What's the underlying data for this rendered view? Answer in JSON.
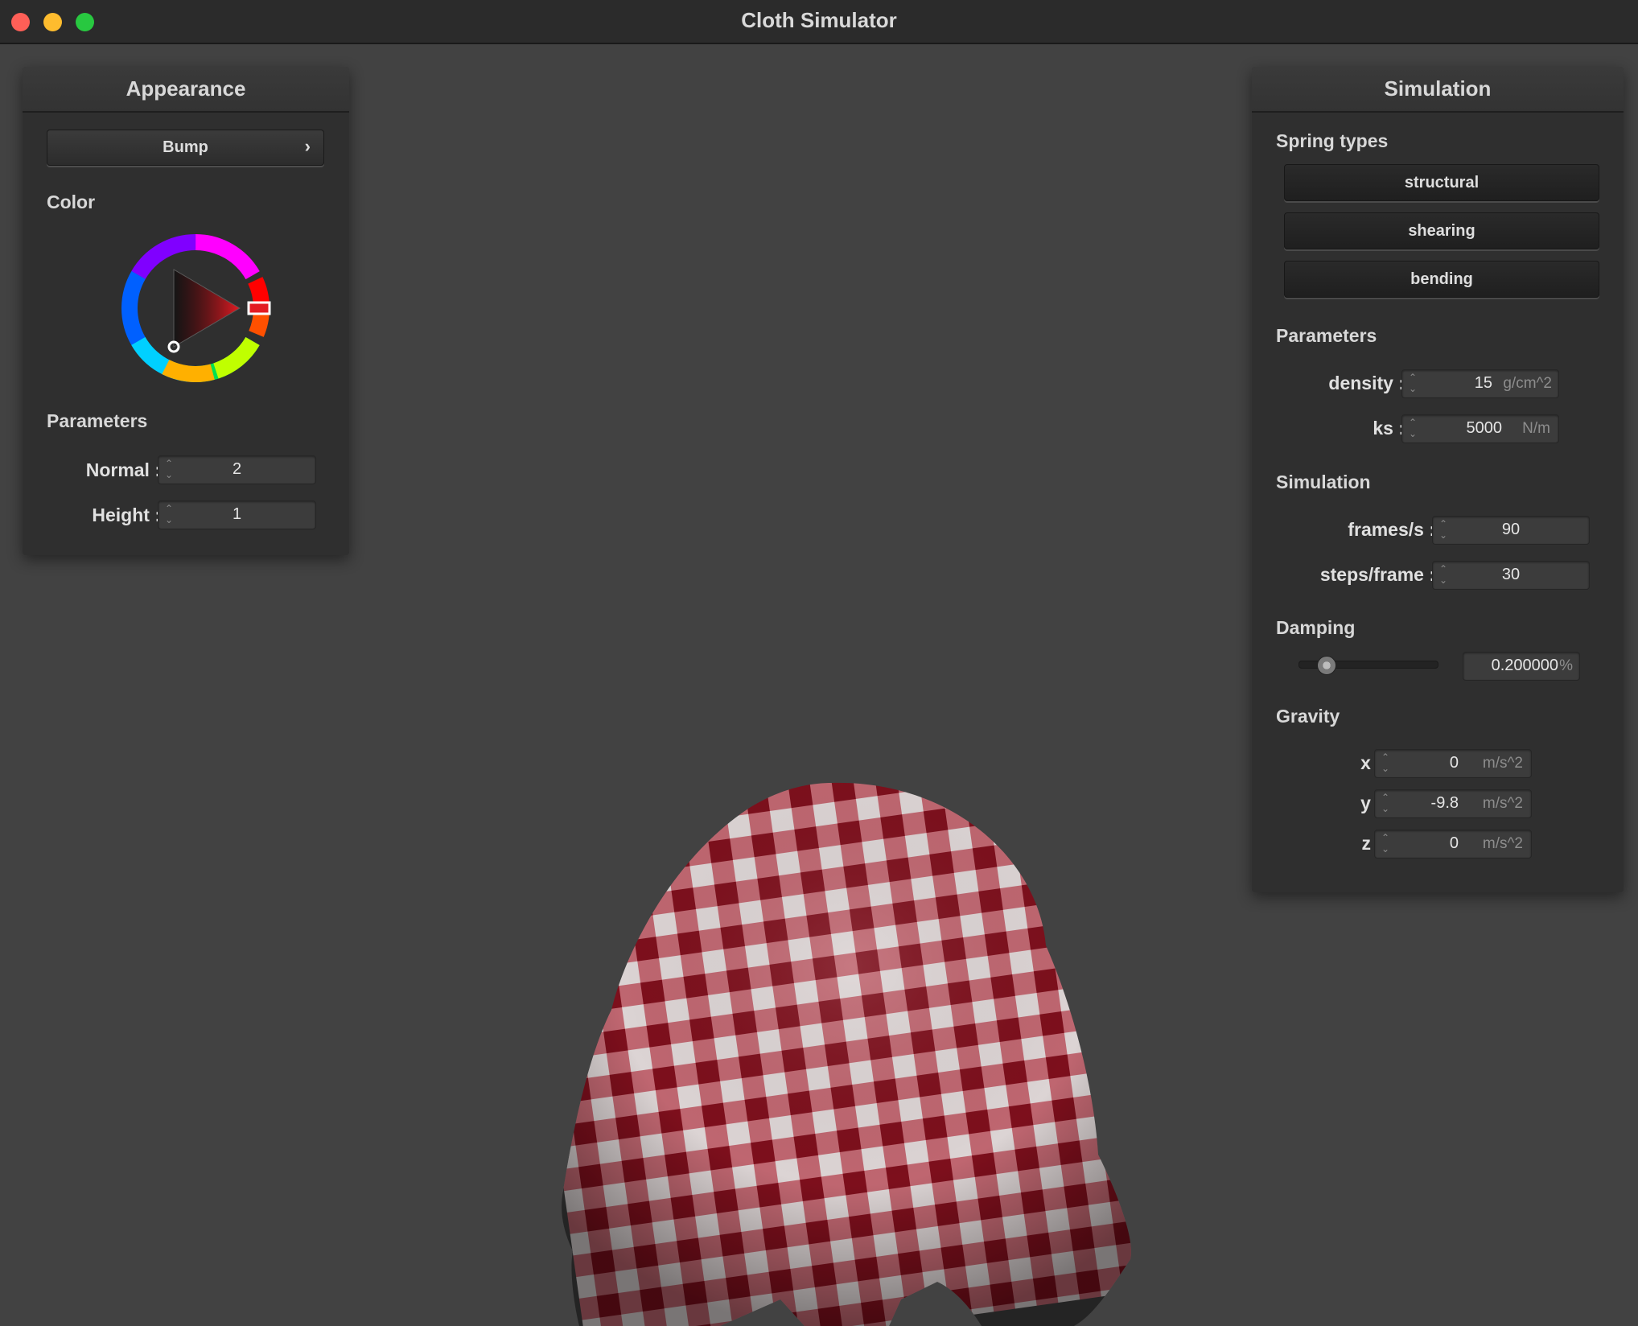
{
  "window": {
    "title": "Cloth Simulator"
  },
  "appearance": {
    "title": "Appearance",
    "shader_selected": "Bump",
    "shader_chevron": "›",
    "color_label": "Color",
    "color_hue": "#e31b23",
    "params_label": "Parameters",
    "normal_label": "Normal :",
    "normal_value": "2",
    "height_label": "Height :",
    "height_value": "1"
  },
  "simulation_panel": {
    "title": "Simulation",
    "spring_types_label": "Spring types",
    "spring_buttons": [
      "structural",
      "shearing",
      "bending"
    ],
    "params_label": "Parameters",
    "density_label": "density :",
    "density_value": "15",
    "density_unit": "g/cm^2",
    "ks_label": "ks :",
    "ks_value": "5000",
    "ks_unit": "N/m",
    "sim_label": "Simulation",
    "fps_label": "frames/s :",
    "fps_value": "90",
    "steps_label": "steps/frame :",
    "steps_value": "30",
    "damping_label": "Damping",
    "damping_value": "0.200000",
    "damping_unit": "%",
    "damping_fraction": 0.2,
    "gravity_label": "Gravity",
    "gx_label": "x :",
    "gx_value": "0",
    "gy_label": "y :",
    "gy_value": "-9.8",
    "gz_label": "z :",
    "gz_value": "0",
    "g_unit": "m/s^2"
  },
  "cloth": {
    "color_red": "#8b1220",
    "color_white": "#d9d2d2"
  }
}
